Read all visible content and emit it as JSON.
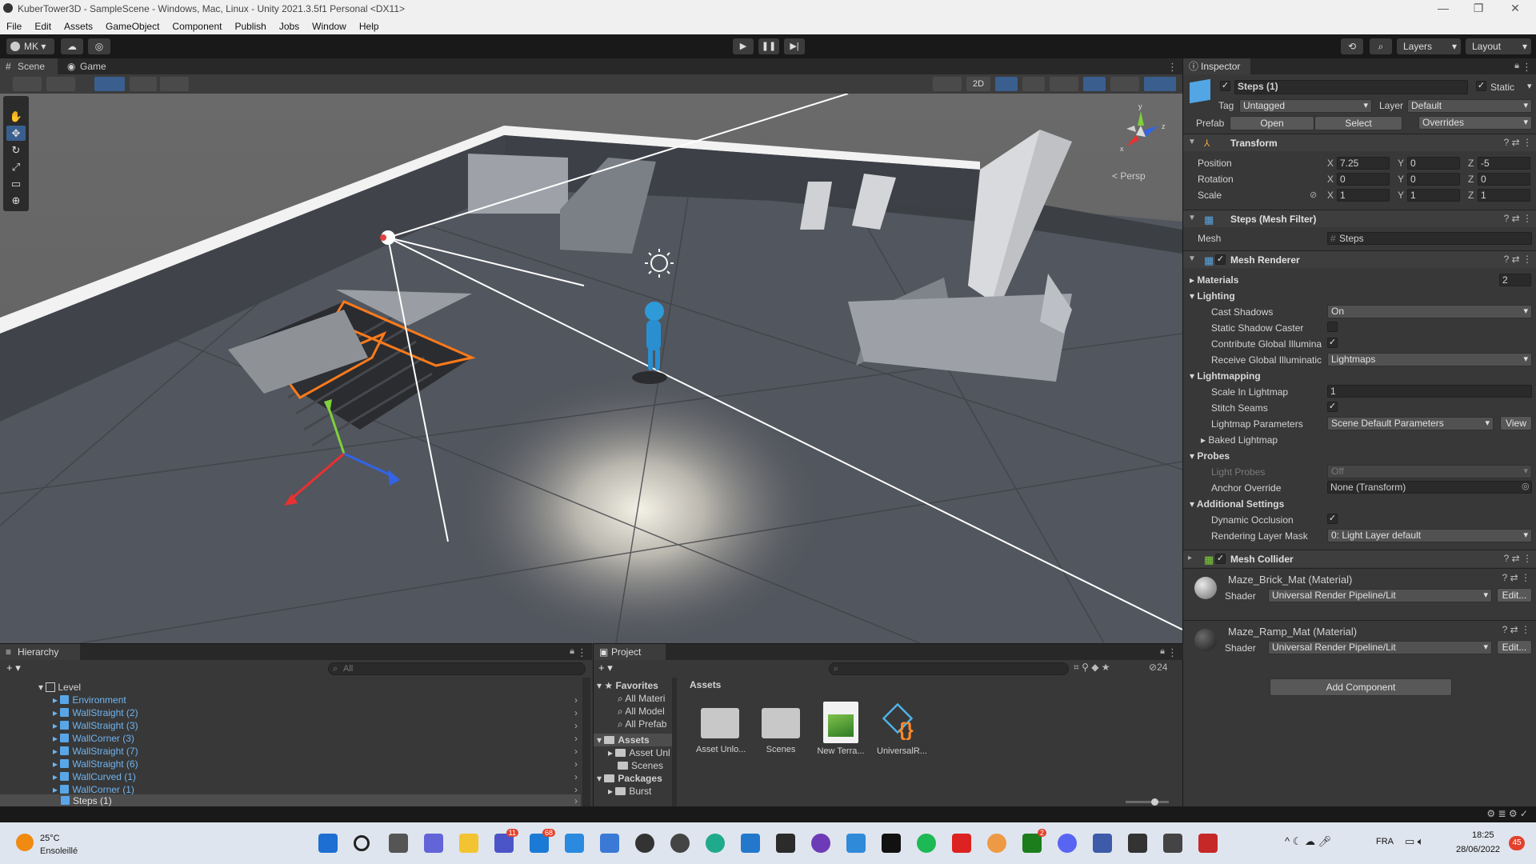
{
  "window": {
    "title": "KuberTower3D - SampleScene - Windows, Mac, Linux - Unity 2021.3.5f1 Personal <DX11>",
    "controls": [
      "—",
      "❐",
      "✕"
    ]
  },
  "menu": [
    "File",
    "Edit",
    "Assets",
    "GameObject",
    "Component",
    "Publish",
    "Jobs",
    "Window",
    "Help"
  ],
  "toolbar": {
    "account": "MK",
    "layers_label": "Layers",
    "layout_label": "Layout"
  },
  "scene_tabs": [
    {
      "label": "Scene",
      "active": true
    },
    {
      "label": "Game",
      "active": false
    }
  ],
  "scene_view": {
    "toggle_2d": "2D",
    "projection": "< Persp",
    "gizmo_axes": [
      "y",
      "x",
      "z"
    ]
  },
  "inspector": {
    "tab": "Inspector",
    "object_name": "Steps (1)",
    "static_label": "Static",
    "tag_label": "Tag",
    "tag_value": "Untagged",
    "layer_label": "Layer",
    "layer_value": "Default",
    "prefab_label": "Prefab",
    "prefab_open": "Open",
    "prefab_select": "Select",
    "prefab_overrides": "Overrides",
    "transform": {
      "title": "Transform",
      "position_label": "Position",
      "rotation_label": "Rotation",
      "scale_label": "Scale",
      "position": {
        "x": "7.25",
        "y": "0",
        "z": "-5"
      },
      "rotation": {
        "x": "0",
        "y": "0",
        "z": "0"
      },
      "scale": {
        "x": "1",
        "y": "1",
        "z": "1"
      }
    },
    "mesh_filter": {
      "title": "Steps (Mesh Filter)",
      "mesh_label": "Mesh",
      "mesh_value": "Steps"
    },
    "mesh_renderer": {
      "title": "Mesh Renderer",
      "materials_label": "Materials",
      "materials_count": "2",
      "lighting_label": "Lighting",
      "cast_shadows_label": "Cast Shadows",
      "cast_shadows_value": "On",
      "static_shadow_label": "Static Shadow Caster",
      "contribute_gi_label": "Contribute Global Illumina",
      "receive_gi_label": "Receive Global Illuminatic",
      "receive_gi_value": "Lightmaps",
      "lightmapping_label": "Lightmapping",
      "scale_lightmap_label": "Scale In Lightmap",
      "scale_lightmap_value": "1",
      "stitch_seams_label": "Stitch Seams",
      "lightmap_params_label": "Lightmap Parameters",
      "lightmap_params_value": "Scene Default Parameters",
      "view_label": "View",
      "baked_lightmap_label": "Baked Lightmap",
      "probes_label": "Probes",
      "light_probes_label": "Light Probes",
      "light_probes_value": "Off",
      "anchor_override_label": "Anchor Override",
      "anchor_override_value": "None (Transform)",
      "additional_label": "Additional Settings",
      "dynamic_occlusion_label": "Dynamic Occlusion",
      "rendering_layer_label": "Rendering Layer Mask",
      "rendering_layer_value": "0: Light Layer default"
    },
    "mesh_collider": {
      "title": "Mesh Collider"
    },
    "materials": [
      {
        "name": "Maze_Brick_Mat (Material)",
        "shader_label": "Shader",
        "shader": "Universal Render Pipeline/Lit",
        "edit": "Edit..."
      },
      {
        "name": "Maze_Ramp_Mat (Material)",
        "shader_label": "Shader",
        "shader": "Universal Render Pipeline/Lit",
        "edit": "Edit..."
      }
    ],
    "add_component": "Add Component"
  },
  "hierarchy": {
    "tab": "Hierarchy",
    "search_placeholder": "All",
    "items": [
      {
        "label": "Level",
        "indent": 0,
        "kind": "root"
      },
      {
        "label": "Environment",
        "indent": 1,
        "kind": "prefab"
      },
      {
        "label": "WallStraight (2)",
        "indent": 1,
        "kind": "prefab"
      },
      {
        "label": "WallStraight (3)",
        "indent": 1,
        "kind": "prefab"
      },
      {
        "label": "WallCorner (3)",
        "indent": 1,
        "kind": "prefab"
      },
      {
        "label": "WallStraight (7)",
        "indent": 1,
        "kind": "prefab"
      },
      {
        "label": "WallStraight (6)",
        "indent": 1,
        "kind": "prefab"
      },
      {
        "label": "WallCurved (1)",
        "indent": 1,
        "kind": "prefab"
      },
      {
        "label": "WallCorner (1)",
        "indent": 1,
        "kind": "prefab"
      },
      {
        "label": "Steps (1)",
        "indent": 1,
        "kind": "selected"
      }
    ]
  },
  "project": {
    "tab": "Project",
    "hidden_count": "24",
    "tree": {
      "favorites": "Favorites",
      "favorites_items": [
        "All Materi",
        "All Model",
        "All Prefab"
      ],
      "assets": "Assets",
      "assets_items": [
        "Asset Unl",
        "Scenes"
      ],
      "packages": "Packages",
      "packages_items": [
        "Burst"
      ]
    },
    "breadcrumb": "Assets",
    "files": [
      {
        "label": "Asset Unlo...",
        "icon": "folder-icon"
      },
      {
        "label": "Scenes",
        "icon": "folder-icon"
      },
      {
        "label": "New Terra...",
        "icon": "terrain-icon"
      },
      {
        "label": "UniversalR...",
        "icon": "urp-asset-icon"
      }
    ]
  },
  "taskbar": {
    "weather_temp": "25°C",
    "weather_desc": "Ensoleillé",
    "language": "FRA",
    "time": "18:25",
    "date": "28/06/2022",
    "notifications": "45",
    "badges": {
      "teams": "11",
      "mail": "68",
      "xbox": "2"
    }
  }
}
